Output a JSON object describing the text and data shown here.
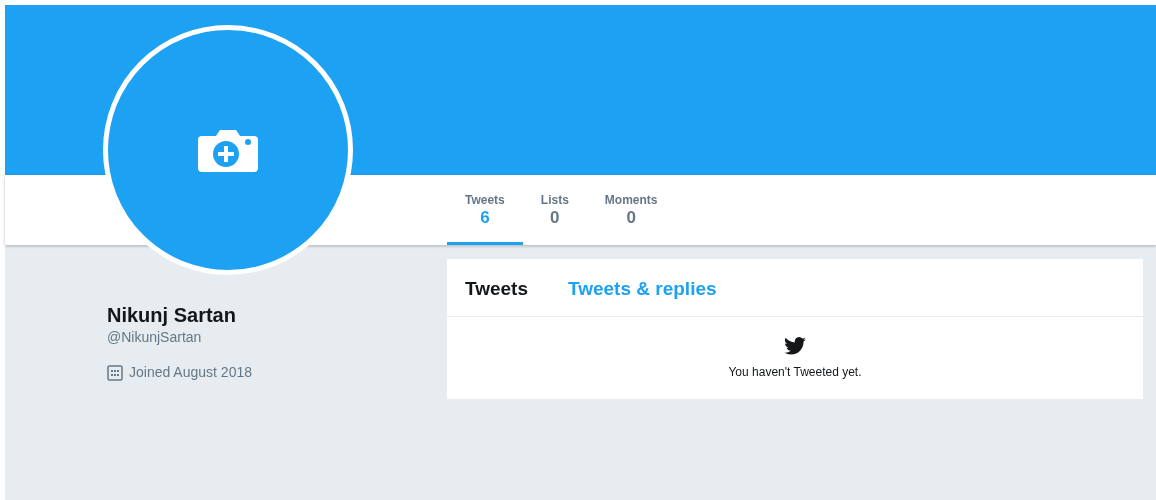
{
  "profile": {
    "name": "Nikunj Sartan",
    "handle": "@NikunjSartan",
    "joined": "Joined August 2018"
  },
  "stats": [
    {
      "label": "Tweets",
      "count": "6",
      "selected": true
    },
    {
      "label": "Lists",
      "count": "0",
      "selected": false
    },
    {
      "label": "Moments",
      "count": "0",
      "selected": false
    }
  ],
  "timeline_tabs": [
    {
      "label": "Tweets",
      "selected": true
    },
    {
      "label": "Tweets & replies",
      "selected": false
    }
  ],
  "empty_state": {
    "message": "You haven't Tweeted yet."
  }
}
